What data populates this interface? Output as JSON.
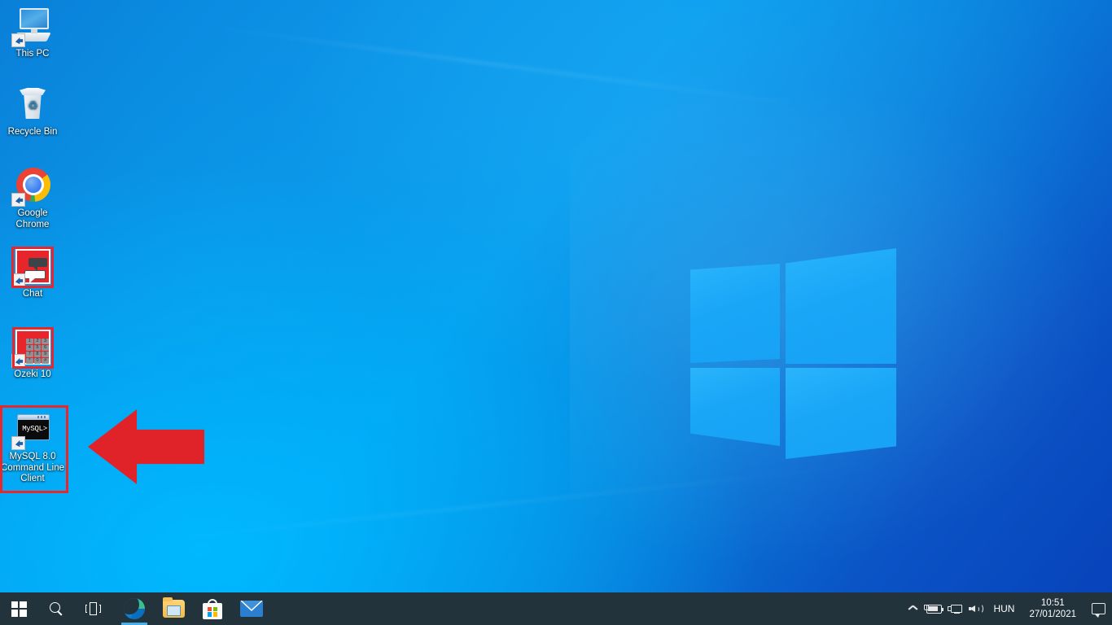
{
  "desktop": {
    "wallpaper_name": "windows-10-hero-logo",
    "background_colors": {
      "top_right": "#0843BC",
      "mid": "#0A9BEA",
      "bottom_left": "#00B3F8"
    },
    "icons": [
      {
        "label": "This PC",
        "icon_name": "this-pc-icon",
        "shortcut": true,
        "highlighted": false
      },
      {
        "label": "Recycle Bin",
        "icon_name": "recycle-bin-icon",
        "shortcut": false,
        "highlighted": false
      },
      {
        "label": "Google Chrome",
        "icon_name": "google-chrome-icon",
        "shortcut": true,
        "highlighted": false
      },
      {
        "label": "Chat",
        "icon_name": "chat-icon",
        "shortcut": true,
        "highlighted": true
      },
      {
        "label": "Ozeki 10",
        "icon_name": "ozeki-10-icon",
        "shortcut": true,
        "highlighted": true
      },
      {
        "label": "MySQL 8.0 Command Line Client",
        "icon_name": "mysql-command-line-client-icon",
        "shortcut": true,
        "highlighted": true,
        "console_text": "MySQL>"
      }
    ],
    "keypad_keys": [
      "1",
      "2",
      "3",
      "4",
      "5",
      "6",
      "7",
      "8",
      "9",
      "*",
      "0",
      "#"
    ],
    "annotation": {
      "type": "arrow",
      "direction": "left",
      "color": "#E02329",
      "points_at": "MySQL 8.0 Command Line Client",
      "name": "red-pointer-arrow"
    },
    "highlight_color": "#E8262B"
  },
  "taskbar": {
    "background_color": "#22333B",
    "start_label": "Start",
    "search_label": "Search",
    "task_view_label": "Task View",
    "apps": [
      {
        "name": "microsoft-edge",
        "label": "Microsoft Edge",
        "active": true
      },
      {
        "name": "file-explorer",
        "label": "File Explorer",
        "active": false
      },
      {
        "name": "microsoft-store",
        "label": "Microsoft Store",
        "active": false
      },
      {
        "name": "mail",
        "label": "Mail",
        "active": false
      }
    ],
    "tray": {
      "show_hidden_label": "Show hidden icons",
      "battery_label": "Battery charging",
      "network_label": "Network",
      "volume_label": "Speakers",
      "language": "HUN",
      "time": "10:51",
      "date": "27/01/2021",
      "action_center_label": "Action Center"
    }
  }
}
